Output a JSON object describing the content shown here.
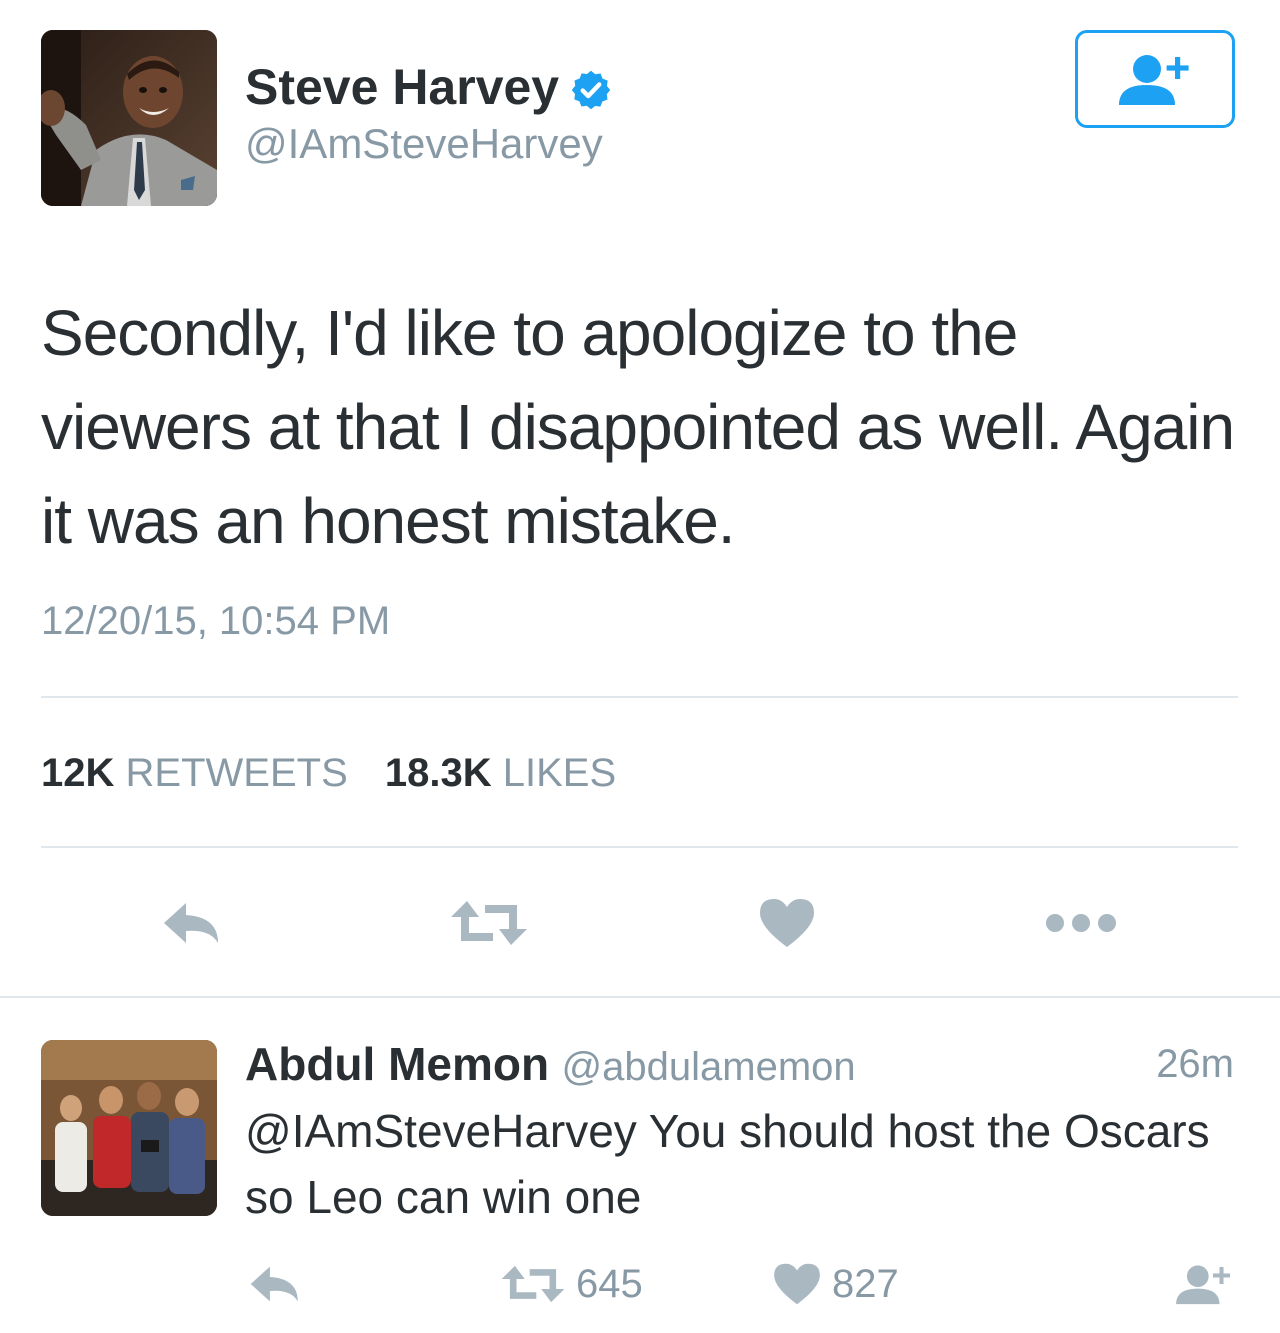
{
  "tweet": {
    "author": {
      "display_name": "Steve Harvey",
      "handle": "@IAmSteveHarvey",
      "verified": true
    },
    "text": "Secondly, I'd like to apologize to the viewers at that I disappointed as well. Again it was an honest mistake.",
    "timestamp": "12/20/15, 10:54 PM",
    "stats": {
      "retweets_count": "12K",
      "retweets_label": "RETWEETS",
      "likes_count": "18.3K",
      "likes_label": "LIKES"
    },
    "actions": [
      "reply-icon",
      "retweet-icon",
      "like-icon",
      "more-icon"
    ]
  },
  "reply": {
    "author": {
      "display_name": "Abdul Memon",
      "handle": "@abdulamemon"
    },
    "time_ago": "26m",
    "text": "@IAmSteveHarvey You should host the Oscars so Leo can win one",
    "retweets_count": "645",
    "likes_count": "827",
    "actions": [
      "reply-icon",
      "retweet-icon",
      "like-icon",
      "follow-icon"
    ]
  },
  "colors": {
    "accent": "#1da1f2",
    "text": "#292f33",
    "secondary": "#8899a6",
    "icon": "#aab8c2",
    "divider": "#e1e8ed"
  }
}
